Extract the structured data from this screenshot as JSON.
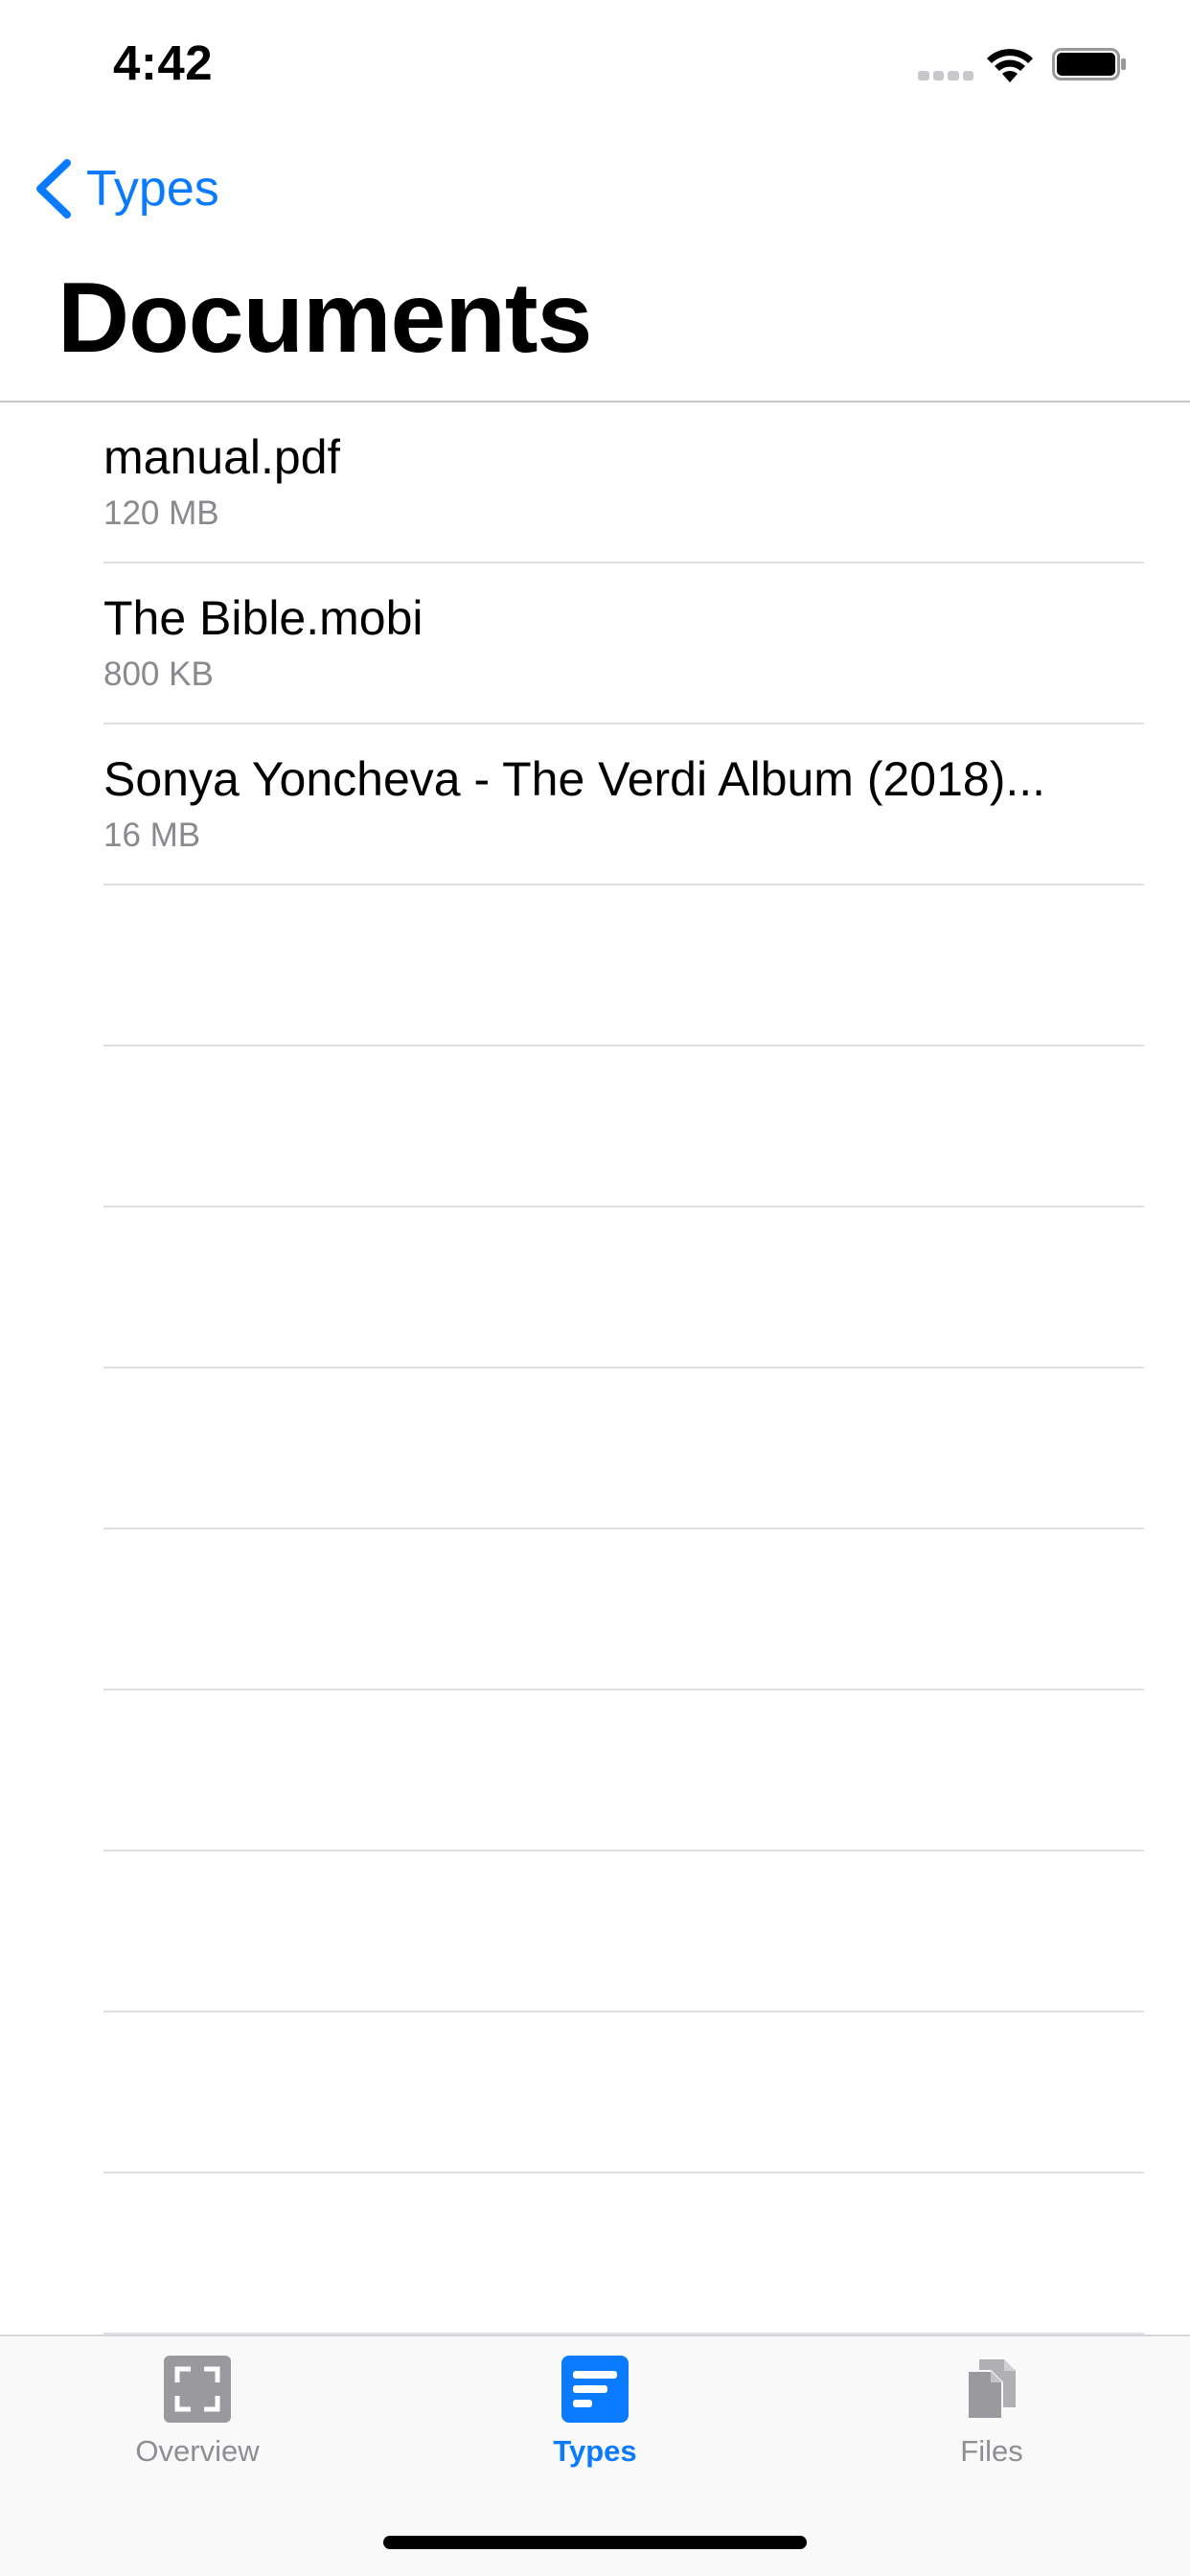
{
  "status_bar": {
    "time": "4:42"
  },
  "nav": {
    "back_label": "Types",
    "title": "Documents"
  },
  "documents": [
    {
      "name": "manual.pdf",
      "size": "120 MB"
    },
    {
      "name": "The Bible.mobi",
      "size": "800 KB"
    },
    {
      "name": "Sonya Yoncheva - The Verdi Album (2018)...",
      "size": "16 MB"
    }
  ],
  "tab_bar": {
    "tabs": [
      {
        "label": "Overview",
        "icon": "overview-icon",
        "active": false
      },
      {
        "label": "Types",
        "icon": "types-icon",
        "active": true
      },
      {
        "label": "Files",
        "icon": "files-icon",
        "active": false
      }
    ]
  },
  "colors": {
    "accent": "#0a7aff",
    "inactive": "#8e8e93",
    "separator": "#e0e0e4"
  }
}
